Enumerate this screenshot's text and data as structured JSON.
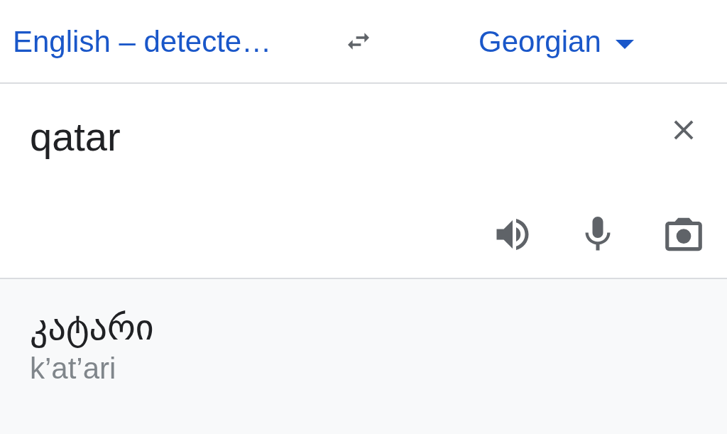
{
  "language_bar": {
    "source_language": "English – detecte…",
    "target_language": "Georgian"
  },
  "input": {
    "value": "qatar"
  },
  "result": {
    "translation": "კატარი",
    "transliteration": "k’at’ari"
  }
}
